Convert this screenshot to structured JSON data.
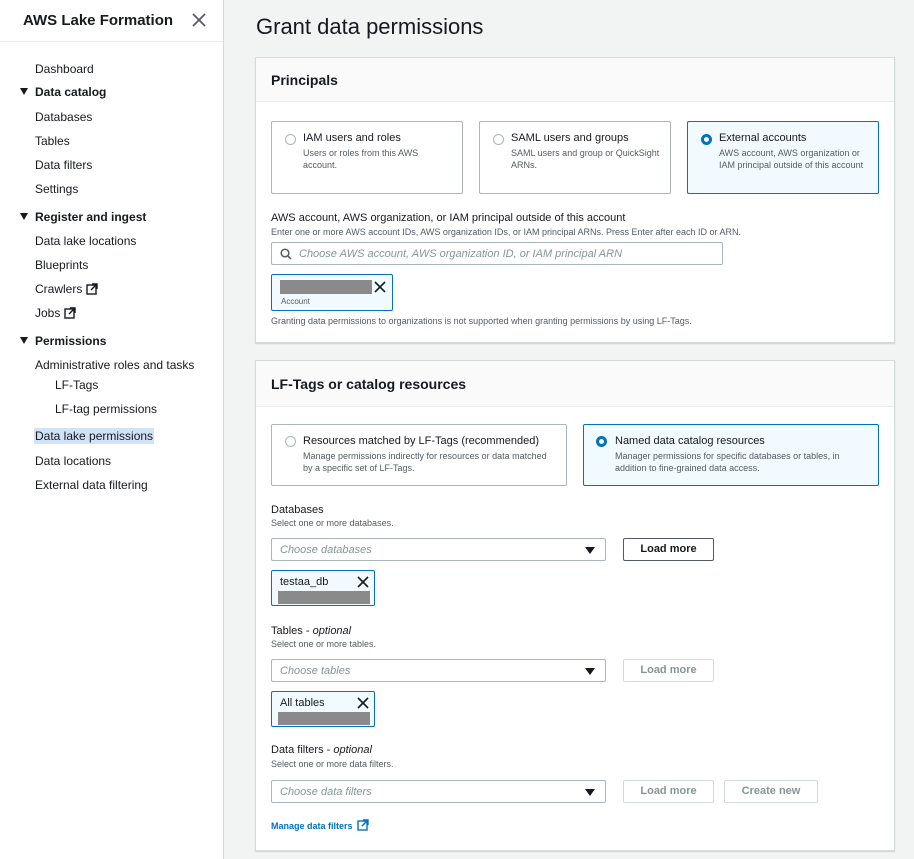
{
  "sidebar": {
    "title": "AWS Lake Formation",
    "items": {
      "dashboard": "Dashboard",
      "data_catalog": "Data catalog",
      "databases": "Databases",
      "tables": "Tables",
      "data_filters": "Data filters",
      "settings": "Settings",
      "register_ingest": "Register and ingest",
      "data_lake_locations": "Data lake locations",
      "blueprints": "Blueprints",
      "crawlers": "Crawlers",
      "jobs": "Jobs",
      "permissions": "Permissions",
      "admin_roles": "Administrative roles and tasks",
      "lf_tags": "LF-Tags",
      "lf_tag_permissions": "LF-tag permissions",
      "data_lake_permissions": "Data lake permissions",
      "data_locations": "Data locations",
      "external_data_filtering": "External data filtering"
    }
  },
  "main": {
    "title": "Grant data permissions",
    "principals": {
      "heading": "Principals",
      "options": [
        {
          "title": "IAM users and roles",
          "desc": "Users or roles from this AWS account.",
          "selected": false
        },
        {
          "title": "SAML users and groups",
          "desc": "SAML users and group or QuickSight ARNs.",
          "selected": false
        },
        {
          "title": "External accounts",
          "desc": "AWS account, AWS organization or IAM principal outside of this account",
          "selected": true
        }
      ],
      "account_label": "AWS account, AWS organization, or IAM principal outside of this account",
      "account_hint": "Enter one or more AWS account IDs, AWS organization IDs, or IAM principal ARNs. Press Enter after each ID or ARN.",
      "account_placeholder": "Choose AWS account, AWS organization ID, or IAM principal ARN",
      "token_sub": "Account",
      "note": "Granting data permissions to organizations is not supported when granting permissions by using LF-Tags."
    },
    "resources": {
      "heading": "LF-Tags or catalog resources",
      "options": [
        {
          "title": "Resources matched by LF-Tags (recommended)",
          "desc": "Manage permissions indirectly for resources or data matched by a specific set of LF-Tags.",
          "selected": false
        },
        {
          "title": "Named data catalog resources",
          "desc": "Manager permissions for specific databases or tables, in addition to fine-grained data access.",
          "selected": true
        }
      ],
      "databases": {
        "label": "Databases",
        "hint": "Select one or more databases.",
        "placeholder": "Choose databases",
        "load_more": "Load more",
        "token": "testaa_db"
      },
      "tables": {
        "label": "Tables",
        "optional": "optional",
        "hint": "Select one or more tables.",
        "placeholder": "Choose tables",
        "load_more": "Load more",
        "token": "All tables"
      },
      "data_filters": {
        "label": "Data filters",
        "optional": "optional",
        "hint": "Select one or more data filters.",
        "placeholder": "Choose data filters",
        "load_more": "Load more",
        "create_new": "Create new"
      },
      "manage_link": "Manage data filters"
    }
  },
  "colors": {
    "accent": "#0073bb",
    "selected_bg": "#f1faff",
    "nav_active_bg": "#d1e3f8"
  }
}
